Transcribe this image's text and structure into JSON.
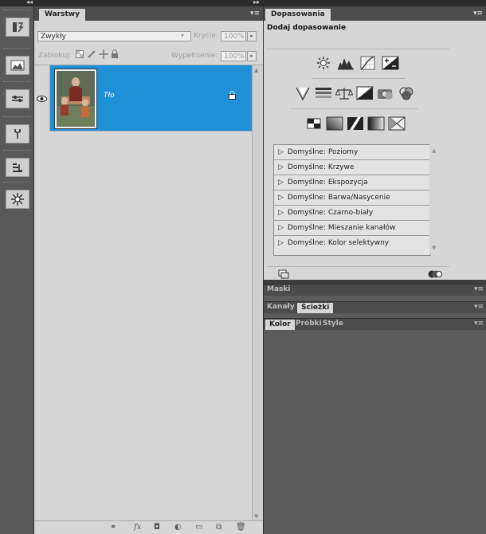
{
  "layers_panel": {
    "tab": "Warstwy",
    "blend_mode": "Zwykły",
    "opacity_label": "Krycie:",
    "opacity_value": "100%",
    "lock_label": "Zablokuj:",
    "fill_label": "Wypełnienie:",
    "fill_value": "100%",
    "layer": {
      "name": "Tło",
      "locked": true,
      "visible": true
    }
  },
  "adjustments_panel": {
    "tab": "Dopasowania",
    "heading": "Dodaj dopasowanie",
    "presets": [
      "Domyślne: Poziomy",
      "Domyślne: Krzywe",
      "Domyślne: Ekspozycja",
      "Domyślne: Barwa/Nasycenie",
      "Domyślne: Czarno-biały",
      "Domyślne: Mieszanie kanałów",
      "Domyślne: Kolor selektywny"
    ]
  },
  "masks_panel": {
    "tab": "Maski"
  },
  "channels_panel": {
    "tabs": [
      "Kanały",
      "Ścieżki"
    ],
    "active": "Ścieżki"
  },
  "color_panel": {
    "tabs": [
      "Kolor",
      "Próbki",
      "Style"
    ],
    "active": "Kolor"
  },
  "colors": {
    "selection": "#1f8fd8",
    "panel_bg": "#d6d6d6",
    "dark_bg": "#5b5b5b"
  }
}
